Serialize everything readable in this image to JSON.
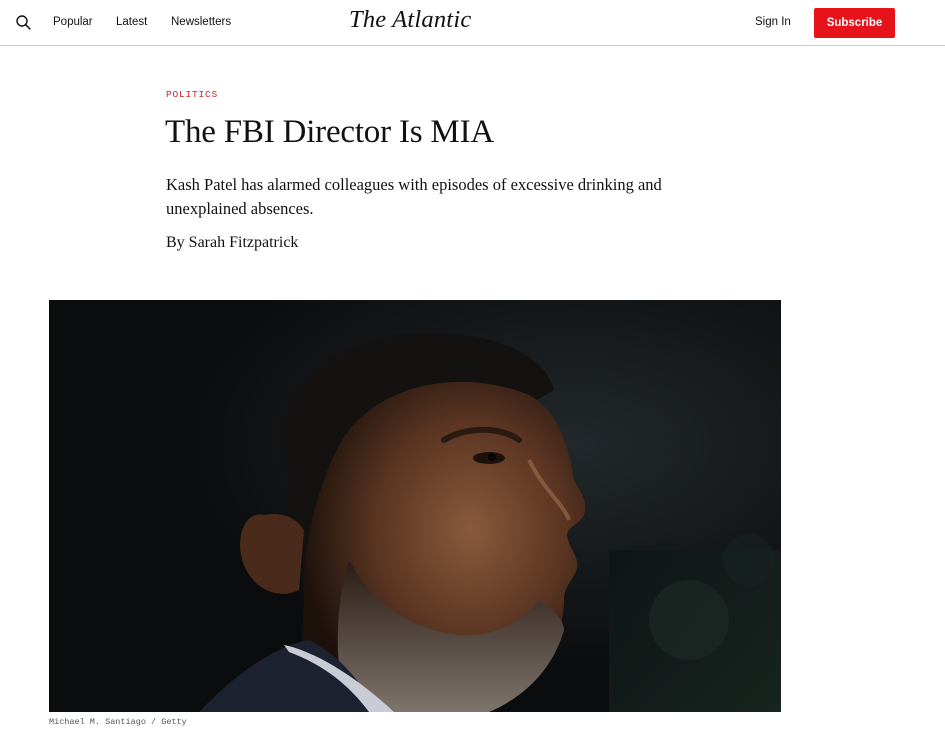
{
  "nav": {
    "search_icon": "search-icon",
    "links": [
      "Popular",
      "Latest",
      "Newsletters"
    ],
    "logo": "The Atlantic",
    "sign_in": "Sign In",
    "subscribe": "Subscribe"
  },
  "article": {
    "section": "POLITICS",
    "headline": "The FBI Director Is MIA",
    "dek": "Kash Patel has alarmed colleagues with episodes of excessive drinking and unexplained absences.",
    "byline_prefix": "By",
    "author": "Sarah Fitzpatrick",
    "image_credit": "Michael M. Santiago / Getty"
  },
  "colors": {
    "accent": "#e7131a",
    "section": "#d1262b",
    "text": "#111111",
    "divider": "#cfcfcf"
  }
}
